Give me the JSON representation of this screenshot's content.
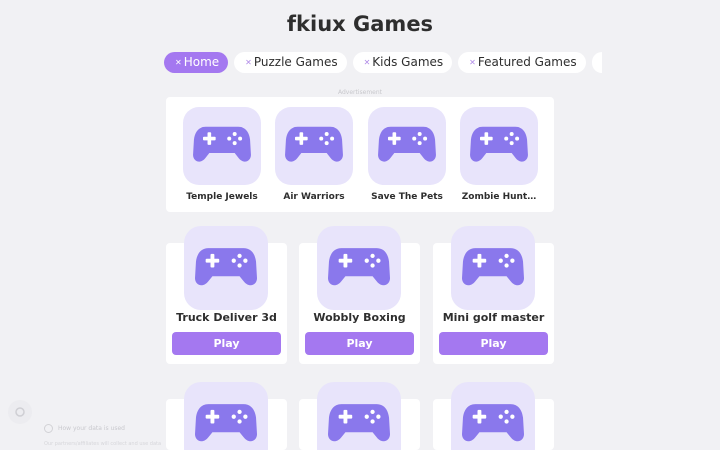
{
  "site_title": "fkiux Games",
  "nav": {
    "tabs": [
      {
        "label": "Home",
        "icon": "close-icon",
        "active": true
      },
      {
        "label": "Puzzle Games",
        "icon": "close-icon",
        "active": false
      },
      {
        "label": "Kids Games",
        "icon": "close-icon",
        "active": false
      },
      {
        "label": "Featured Games",
        "icon": "close-icon",
        "active": false
      }
    ]
  },
  "ad_label": "Advertisement",
  "featured": [
    {
      "name": "Temple Jewels",
      "icon": "gamepad-icon"
    },
    {
      "name": "Air Warriors",
      "icon": "gamepad-icon"
    },
    {
      "name": "Save The Pets",
      "icon": "gamepad-icon"
    },
    {
      "name": "Zombie Hunt…",
      "icon": "gamepad-icon"
    }
  ],
  "games": [
    {
      "name": "Truck Deliver 3d",
      "play_label": "Play",
      "icon": "gamepad-icon"
    },
    {
      "name": "Wobbly Boxing",
      "play_label": "Play",
      "icon": "gamepad-icon"
    },
    {
      "name": "Mini golf master",
      "play_label": "Play",
      "icon": "gamepad-icon"
    },
    {
      "name": "",
      "play_label": "",
      "icon": "gamepad-icon"
    },
    {
      "name": "",
      "play_label": "",
      "icon": "gamepad-icon"
    },
    {
      "name": "",
      "play_label": "",
      "icon": "gamepad-icon"
    }
  ],
  "consent": {
    "note": "How your data is used",
    "sub": "Our partners/affiliates will collect and use data"
  },
  "colors": {
    "accent": "#a478f0",
    "icon": "#8a78ec",
    "tile": "#e8e4fb",
    "background": "#f1f1f4"
  }
}
